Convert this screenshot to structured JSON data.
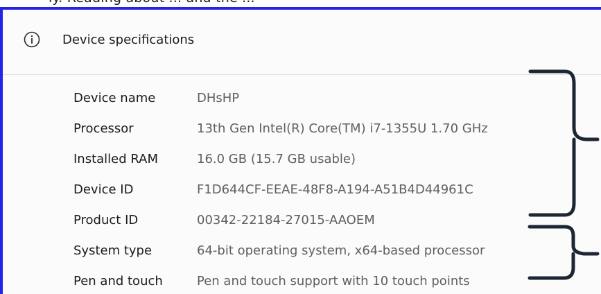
{
  "window": {
    "partial_top_text": "ly. Reading about ... and the ..."
  },
  "header": {
    "title": "Device specifications",
    "icon": "info-icon"
  },
  "specs": [
    {
      "label": "Device name",
      "value": "DHsHP"
    },
    {
      "label": "Processor",
      "value": "13th Gen Intel(R) Core(TM) i7-1355U   1.70 GHz"
    },
    {
      "label": "Installed RAM",
      "value": "16.0 GB (15.7 GB usable)"
    },
    {
      "label": "Device ID",
      "value": "F1D644CF-EEAE-48F8-A194-A51B4D44961C"
    },
    {
      "label": "Product ID",
      "value": "00342-22184-27015-AAOEM"
    },
    {
      "label": "System type",
      "value": "64-bit operating system, x64-based processor"
    },
    {
      "label": "Pen and touch",
      "value": "Pen and touch support with 10 touch points"
    }
  ],
  "colors": {
    "frame": "#2424e6",
    "annotation": "#1d2733",
    "label_text": "#1b1b1b",
    "value_text": "#5f5f5f"
  }
}
